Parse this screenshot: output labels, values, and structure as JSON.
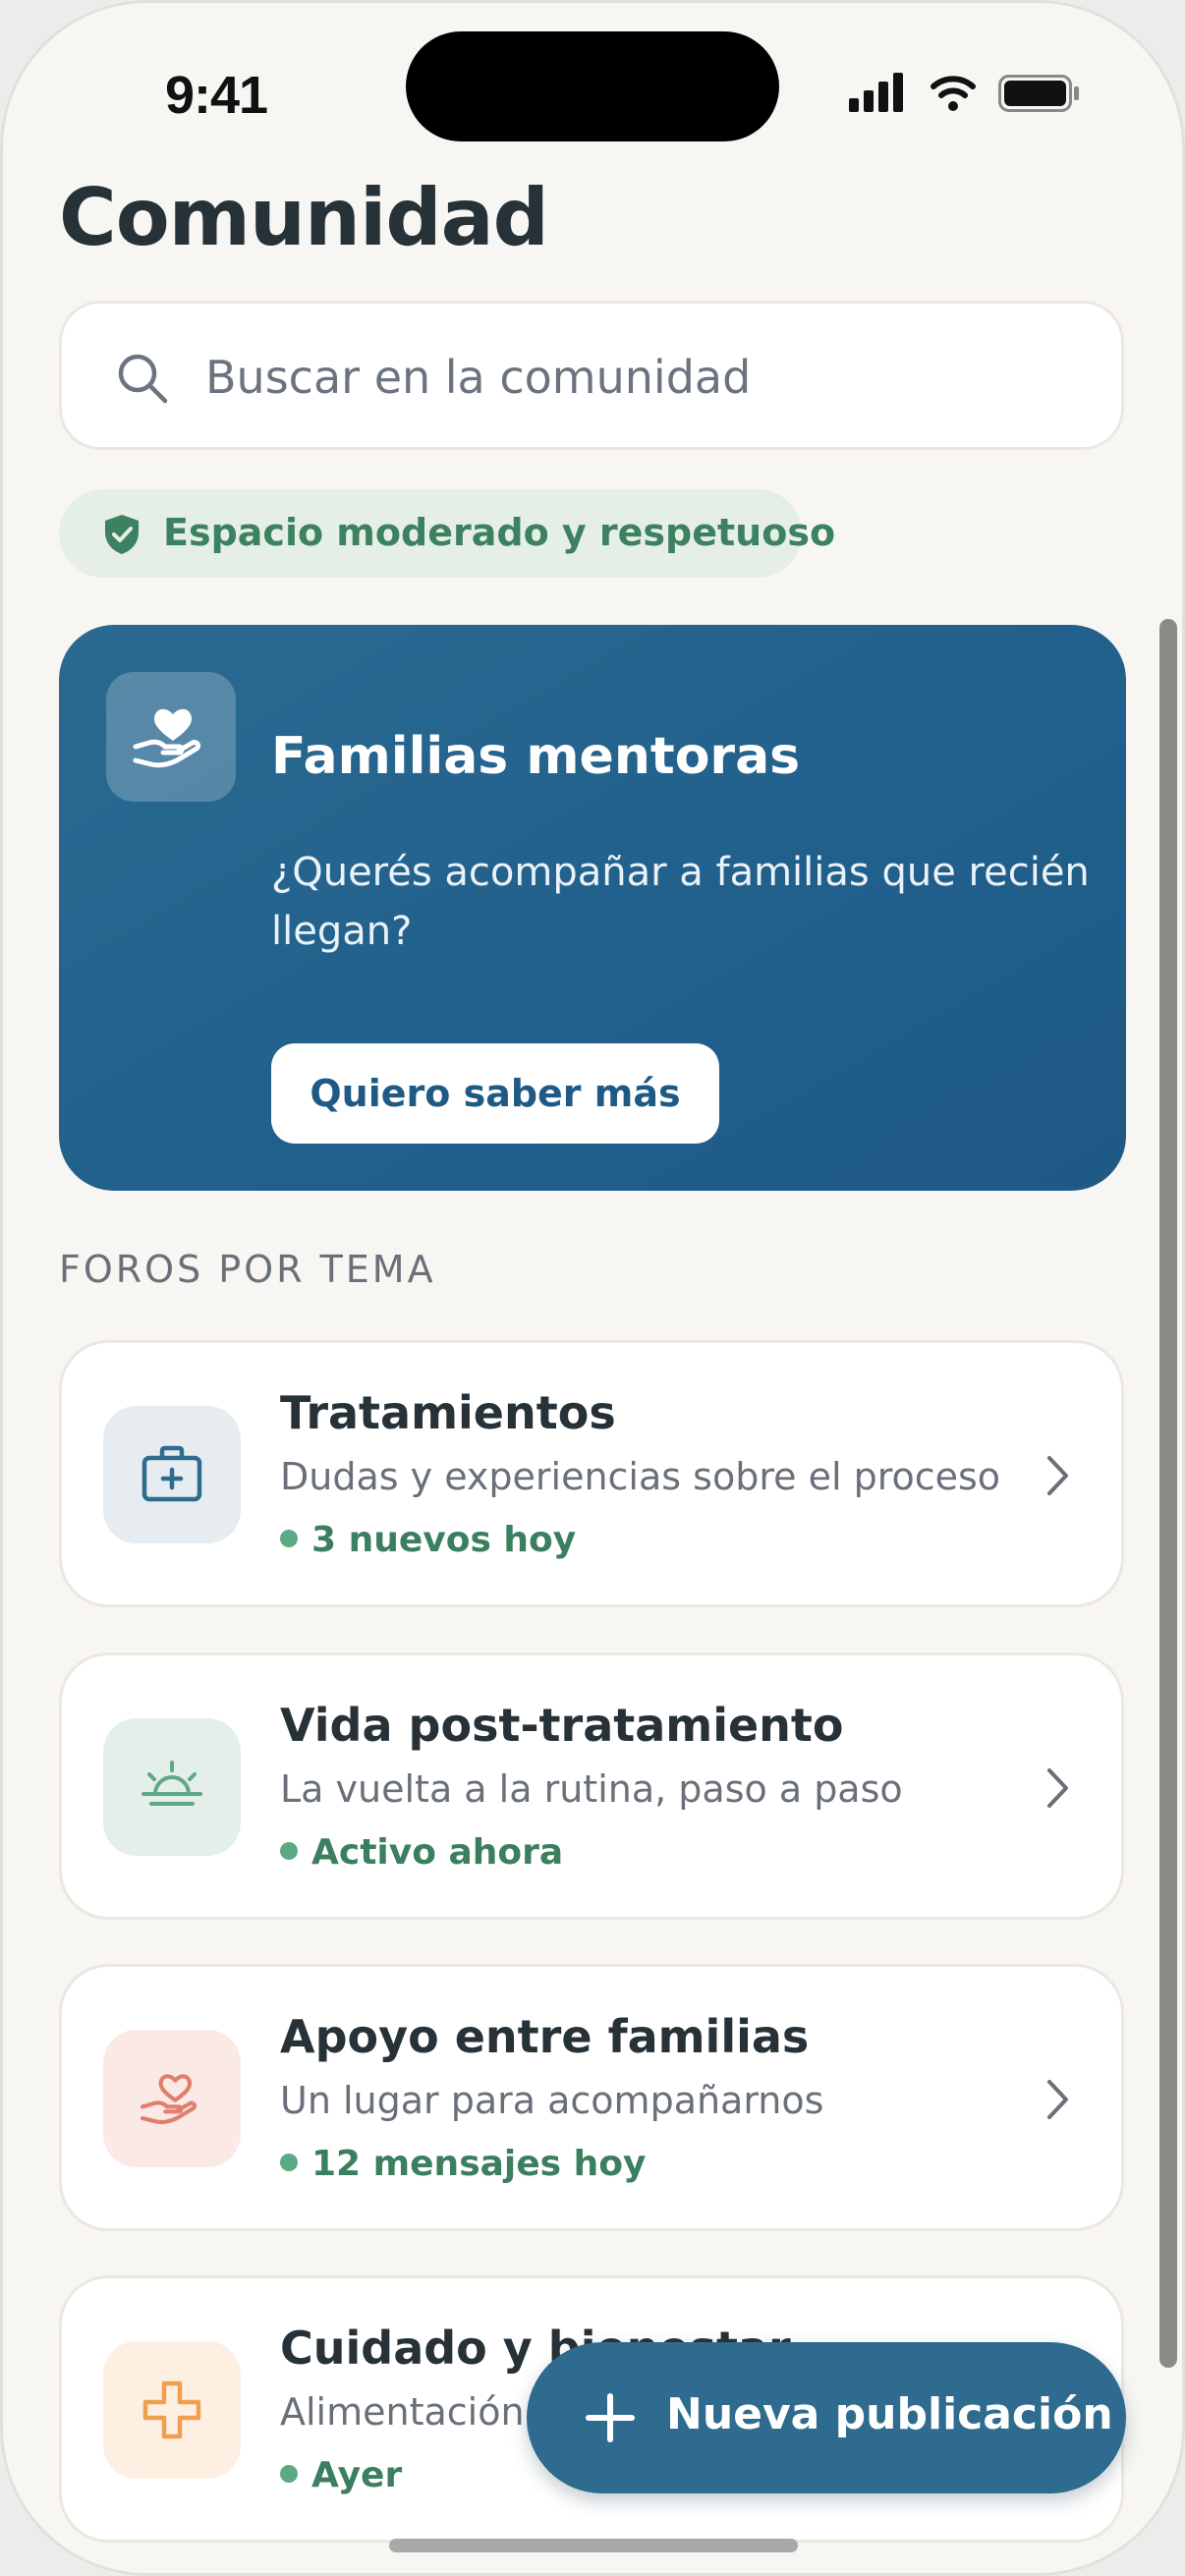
{
  "status_bar": {
    "time": "9:41"
  },
  "page": {
    "title": "Comunidad"
  },
  "search": {
    "placeholder": "Buscar en la comunidad"
  },
  "moderation_badge": {
    "label": "Espacio moderado y respetuoso"
  },
  "mentor_card": {
    "title": "Familias mentoras",
    "description": "¿Querés acompañar a familias que recién llegan?",
    "button_label": "Quiero saber más"
  },
  "forums": {
    "section_label": "FOROS POR TEMA",
    "items": [
      {
        "title": "Tratamientos",
        "subtitle": "Dudas y experiencias sobre el proceso",
        "status": "3 nuevos hoy",
        "icon": "medical-kit-icon",
        "icon_bg": "#e6ecef",
        "icon_color": "#2e6b8f"
      },
      {
        "title": "Vida post-tratamiento",
        "subtitle": "La vuelta a la rutina, paso a paso",
        "status": "Activo ahora",
        "icon": "sunrise-icon",
        "icon_bg": "#e4efe9",
        "icon_color": "#5ea985"
      },
      {
        "title": "Apoyo entre familias",
        "subtitle": "Un lugar para acompañarnos",
        "status": "12 mensajes hoy",
        "icon": "heart-hand-icon",
        "icon_bg": "#fbe9e6",
        "icon_color": "#e07f6d"
      },
      {
        "title": "Cuidado y bienestar",
        "subtitle": "Alimentación, descanso y bienestar",
        "status": "Ayer",
        "icon": "plus-cross-icon",
        "icon_bg": "#fdf0e2",
        "icon_color": "#ef9f4f"
      }
    ]
  },
  "fab": {
    "label": "Nueva publicación"
  },
  "colors": {
    "background": "#f8f6f2",
    "primary": "#2e6b8f",
    "accent_green": "#3b7f5e",
    "text_dark": "#263238",
    "text_muted": "#6a7079"
  }
}
